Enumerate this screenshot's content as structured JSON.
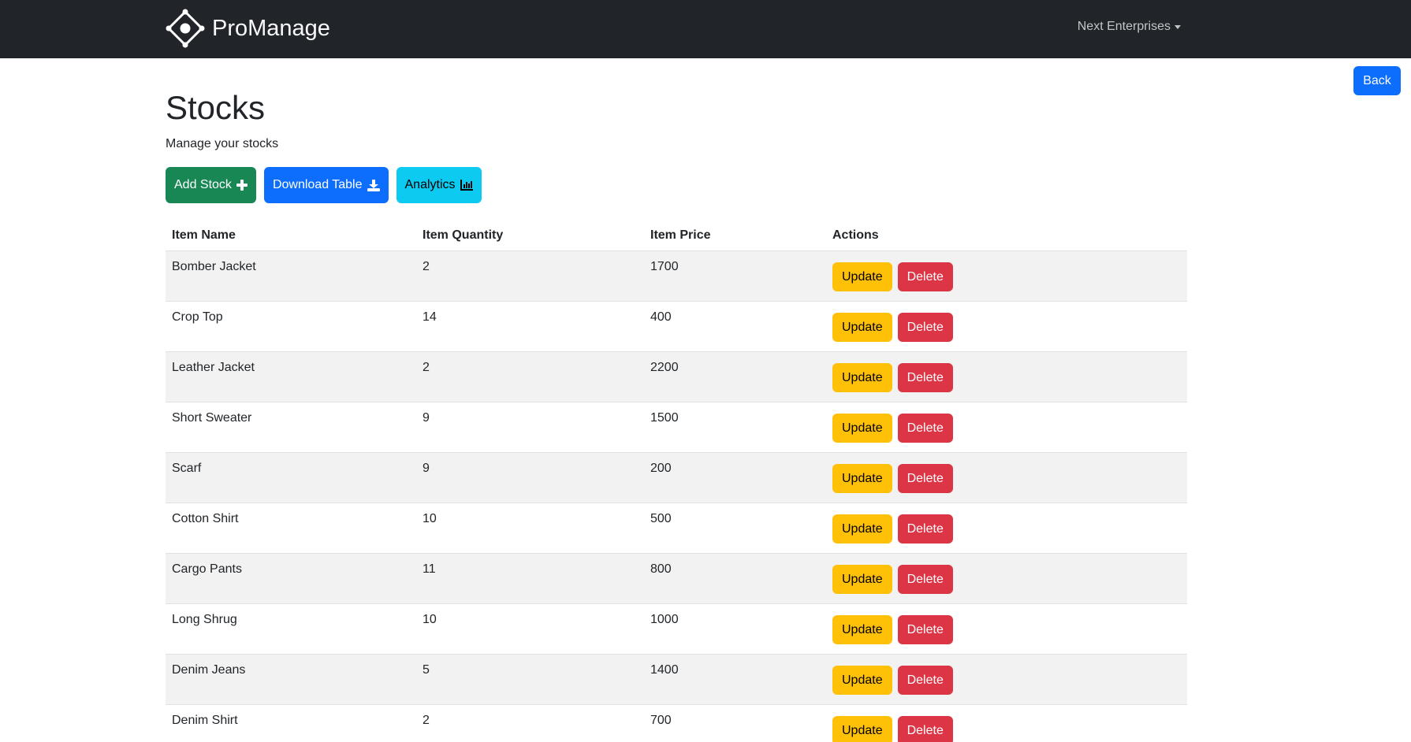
{
  "app": {
    "brand_name": "ProManage",
    "organization": "Next Enterprises"
  },
  "nav": {
    "back_label": "Back"
  },
  "page": {
    "title": "Stocks",
    "subtitle": "Manage your stocks"
  },
  "toolbar": {
    "add_label": "Add Stock",
    "download_label": "Download Table",
    "analytics_label": "Analytics",
    "add_icon": "plus-icon",
    "download_icon": "download-icon",
    "analytics_icon": "bar-chart-icon"
  },
  "table": {
    "headers": [
      "Item Name",
      "Item Quantity",
      "Item Price",
      "Actions"
    ],
    "update_label": "Update",
    "delete_label": "Delete",
    "rows": [
      {
        "name": "Bomber Jacket",
        "quantity": "2",
        "price": "1700"
      },
      {
        "name": "Crop Top",
        "quantity": "14",
        "price": "400"
      },
      {
        "name": "Leather Jacket",
        "quantity": "2",
        "price": "2200"
      },
      {
        "name": "Short Sweater",
        "quantity": "9",
        "price": "1500"
      },
      {
        "name": "Scarf",
        "quantity": "9",
        "price": "200"
      },
      {
        "name": "Cotton Shirt",
        "quantity": "10",
        "price": "500"
      },
      {
        "name": "Cargo Pants",
        "quantity": "11",
        "price": "800"
      },
      {
        "name": "Long Shrug",
        "quantity": "10",
        "price": "1000"
      },
      {
        "name": "Denim Jeans",
        "quantity": "5",
        "price": "1400"
      },
      {
        "name": "Denim Shirt",
        "quantity": "2",
        "price": "700"
      }
    ]
  },
  "colors": {
    "navbar": "#212529",
    "primary": "#0d6efd",
    "success": "#198754",
    "info": "#0dcaf0",
    "warning": "#ffc107",
    "danger": "#dc3545",
    "striped_row": "#f2f2f2"
  }
}
